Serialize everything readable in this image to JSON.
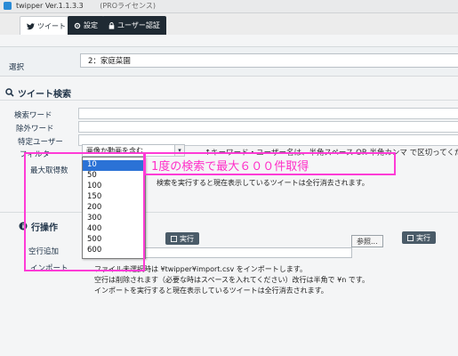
{
  "window": {
    "title": "twipper Ver.1.1.3.3",
    "edition": "(PROライセンス)"
  },
  "tabs": [
    {
      "label": "ツイート",
      "icon": "twitter-bird-icon",
      "active": true
    },
    {
      "label": "設定",
      "icon": "gear-icon",
      "active": false
    },
    {
      "label": "ユーザー認証",
      "icon": "lock-icon",
      "active": false
    }
  ],
  "selection": {
    "label": "選択",
    "value": "2：家庭菜園"
  },
  "search": {
    "section_title": "ツイート検索",
    "keyword_label": "検索ワード",
    "exclude_label": "除外ワード",
    "user_label": "特定ユーザー",
    "filter_label": "フィルター",
    "filter_value": "画像か動画を含む",
    "hint": "↑キーワード・ユーザー名は、半角スペース OR 半角カンマ で区切ってください",
    "max_label": "最大取得数",
    "max_options": [
      "10",
      "50",
      "100",
      "150",
      "200",
      "300",
      "400",
      "500",
      "600"
    ],
    "max_selected": "10",
    "execute_note": "検索を実行すると現在表示しているツイートは全行消去されます。"
  },
  "row_ops": {
    "section_title": "行操作",
    "add_empty_label": "空行追加",
    "execute_label": "実行",
    "import_label": "インポート",
    "browse_label": "参照...",
    "import_execute_label": "実行",
    "notes": [
      "ファイル未選択時は ¥twipper¥import.csv をインポートします。",
      "空行は削除されます（必要な時はスペースを入れてください）改行は半角で ¥n です。",
      "インポートを実行すると現在表示しているツイートは全行消去されます。"
    ]
  },
  "annotation": {
    "text": "1度の検索で最大６００件取得",
    "color": "#ff3bd6"
  }
}
